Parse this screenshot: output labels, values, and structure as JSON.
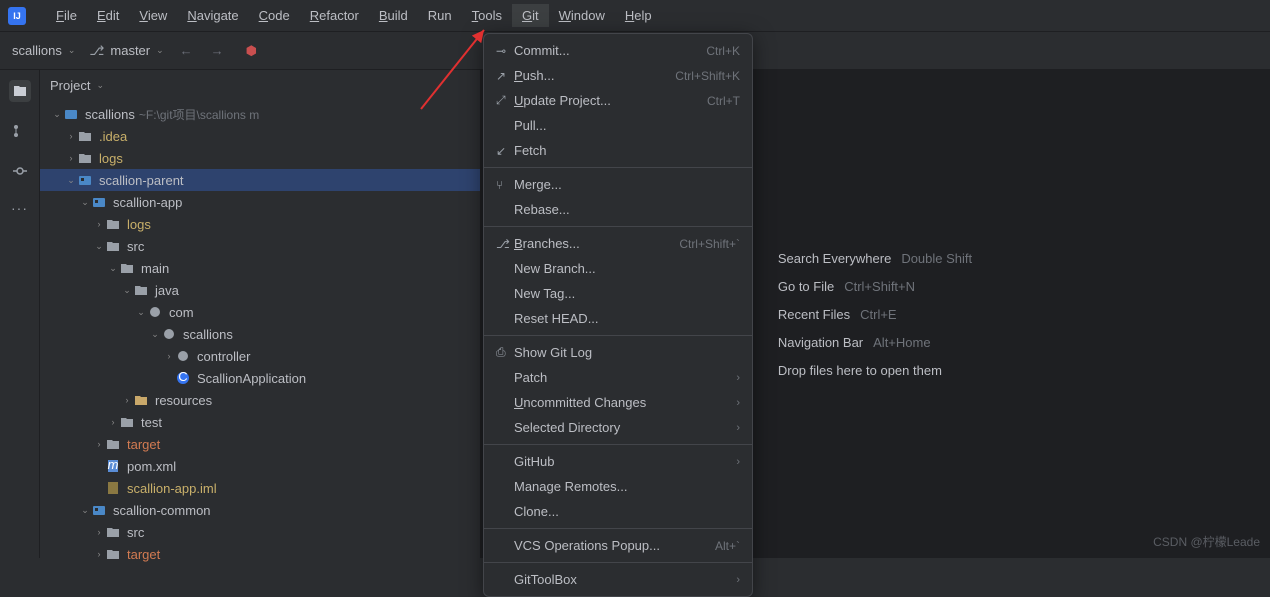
{
  "menubar": {
    "items": [
      {
        "label": "File",
        "u": "F"
      },
      {
        "label": "Edit",
        "u": "E"
      },
      {
        "label": "View",
        "u": "V"
      },
      {
        "label": "Navigate",
        "u": "N"
      },
      {
        "label": "Code",
        "u": "C"
      },
      {
        "label": "Refactor",
        "u": "R"
      },
      {
        "label": "Build",
        "u": "B"
      },
      {
        "label": "Run",
        "u": ""
      },
      {
        "label": "Tools",
        "u": "T"
      },
      {
        "label": "Git",
        "u": "G",
        "active": true
      },
      {
        "label": "Window",
        "u": "W"
      },
      {
        "label": "Help",
        "u": "H"
      }
    ]
  },
  "toolbar": {
    "project": "scallions",
    "branch": "master"
  },
  "project_header": "Project",
  "tree": [
    {
      "depth": 0,
      "exp": "v",
      "icon": "proj",
      "name": "scallions",
      "suffix": "~F:\\git项目\\scallions m"
    },
    {
      "depth": 1,
      "exp": ">",
      "icon": "folder",
      "name": ".idea",
      "cls": "yellow"
    },
    {
      "depth": 1,
      "exp": ">",
      "icon": "folder",
      "name": "logs",
      "cls": "yellow"
    },
    {
      "depth": 1,
      "exp": "v",
      "icon": "mod",
      "name": "scallion-parent",
      "sel": true
    },
    {
      "depth": 2,
      "exp": "v",
      "icon": "mod",
      "name": "scallion-app"
    },
    {
      "depth": 3,
      "exp": ">",
      "icon": "folder",
      "name": "logs",
      "cls": "yellow"
    },
    {
      "depth": 3,
      "exp": "v",
      "icon": "folder",
      "name": "src"
    },
    {
      "depth": 4,
      "exp": "v",
      "icon": "folder",
      "name": "main"
    },
    {
      "depth": 5,
      "exp": "v",
      "icon": "folder",
      "name": "java"
    },
    {
      "depth": 6,
      "exp": "v",
      "icon": "pkg",
      "name": "com"
    },
    {
      "depth": 7,
      "exp": "v",
      "icon": "pkg",
      "name": "scallions"
    },
    {
      "depth": 8,
      "exp": ">",
      "icon": "pkg",
      "name": "controller"
    },
    {
      "depth": 8,
      "exp": "",
      "icon": "class",
      "name": "ScallionApplication"
    },
    {
      "depth": 5,
      "exp": ">",
      "icon": "res",
      "name": "resources"
    },
    {
      "depth": 4,
      "exp": ">",
      "icon": "folder",
      "name": "test"
    },
    {
      "depth": 3,
      "exp": ">",
      "icon": "folder",
      "name": "target",
      "cls": "orange"
    },
    {
      "depth": 3,
      "exp": "",
      "icon": "xml",
      "name": "pom.xml"
    },
    {
      "depth": 3,
      "exp": "",
      "icon": "iml",
      "name": "scallion-app.iml",
      "cls": "yellow"
    },
    {
      "depth": 2,
      "exp": "v",
      "icon": "mod",
      "name": "scallion-common"
    },
    {
      "depth": 3,
      "exp": ">",
      "icon": "folder",
      "name": "src"
    },
    {
      "depth": 3,
      "exp": ">",
      "icon": "folder",
      "name": "target",
      "cls": "orange"
    }
  ],
  "git_menu": [
    {
      "icon": "commit",
      "label": "Commit...",
      "u": "",
      "shortcut": "Ctrl+K"
    },
    {
      "icon": "push",
      "label": "Push...",
      "u": "P",
      "shortcut": "Ctrl+Shift+K"
    },
    {
      "icon": "update",
      "label": "Update Project...",
      "u": "U",
      "shortcut": "Ctrl+T"
    },
    {
      "icon": "",
      "label": "Pull..."
    },
    {
      "icon": "fetch",
      "label": "Fetch"
    },
    {
      "sep": true
    },
    {
      "icon": "merge",
      "label": "Merge..."
    },
    {
      "icon": "",
      "label": "Rebase..."
    },
    {
      "sep": true
    },
    {
      "icon": "branch",
      "label": "Branches...",
      "u": "B",
      "shortcut": "Ctrl+Shift+`"
    },
    {
      "icon": "",
      "label": "New Branch..."
    },
    {
      "icon": "",
      "label": "New Tag..."
    },
    {
      "icon": "",
      "label": "Reset HEAD..."
    },
    {
      "sep": true
    },
    {
      "icon": "log",
      "label": "Show Git Log"
    },
    {
      "icon": "",
      "label": "Patch",
      "sub": true
    },
    {
      "icon": "",
      "label": "Uncommitted Changes",
      "u": "U",
      "sub": true
    },
    {
      "icon": "",
      "label": "Selected Directory",
      "sub": true
    },
    {
      "sep": true
    },
    {
      "icon": "",
      "label": "GitHub",
      "sub": true
    },
    {
      "icon": "",
      "label": "Manage Remotes..."
    },
    {
      "icon": "",
      "label": "Clone..."
    },
    {
      "sep": true
    },
    {
      "icon": "",
      "label": "VCS Operations Popup...",
      "shortcut": "Alt+`"
    },
    {
      "sep": true
    },
    {
      "icon": "",
      "label": "GitToolBox",
      "sub": true
    }
  ],
  "welcome": [
    {
      "label": "Search Everywhere",
      "shortcut": "Double Shift"
    },
    {
      "label": "Go to File",
      "shortcut": "Ctrl+Shift+N"
    },
    {
      "label": "Recent Files",
      "shortcut": "Ctrl+E"
    },
    {
      "label": "Navigation Bar",
      "shortcut": "Alt+Home"
    },
    {
      "label": "Drop files here to open them",
      "shortcut": ""
    }
  ],
  "watermark": "CSDN @柠檬Leade"
}
